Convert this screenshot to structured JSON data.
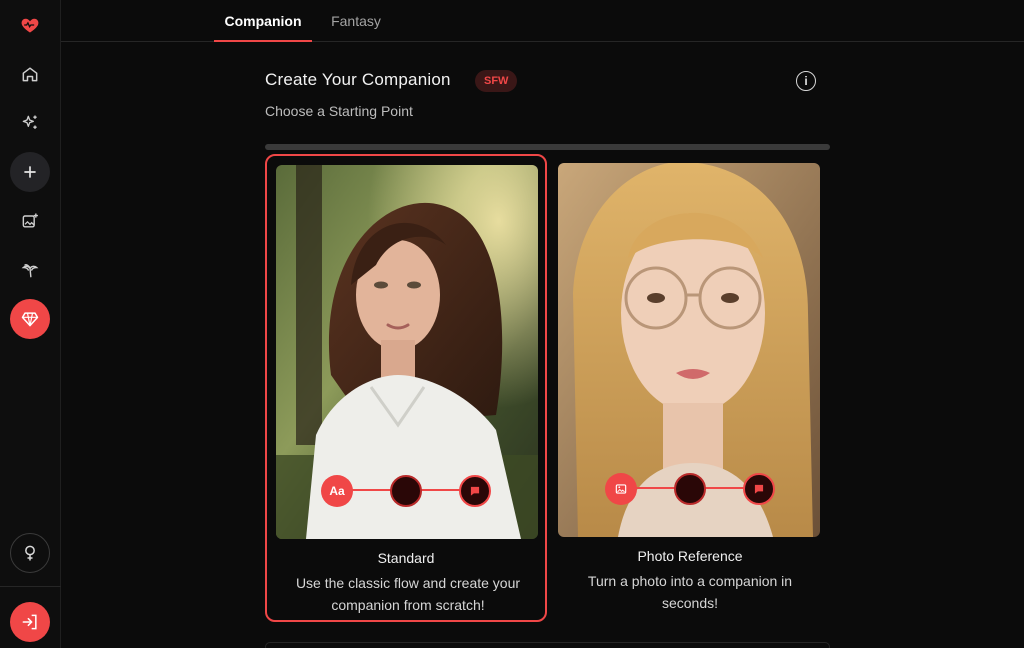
{
  "tabs": [
    {
      "label": "Companion",
      "active": true
    },
    {
      "label": "Fantasy",
      "active": false
    }
  ],
  "header": {
    "title": "Create Your Companion",
    "badge": "SFW",
    "subtitle": "Choose a Starting Point",
    "info_icon": "info-icon"
  },
  "progress": {
    "value": 0
  },
  "sidebar": {
    "items": [
      {
        "icon": "heart-pulse-logo-icon"
      },
      {
        "icon": "home-icon"
      },
      {
        "icon": "sparkles-icon"
      },
      {
        "icon": "plus-icon"
      },
      {
        "icon": "image-add-icon"
      },
      {
        "icon": "palm-tree-icon"
      },
      {
        "icon": "diamond-icon"
      },
      {
        "icon": "female-icon"
      },
      {
        "icon": "login-icon"
      }
    ]
  },
  "cards": [
    {
      "title": "Standard",
      "description": "Use the classic flow and create your companion from scratch!",
      "selected": true,
      "step_icons": [
        "text-aa-icon",
        "empty-step-icon",
        "chat-icon"
      ],
      "step_text": "Aa"
    },
    {
      "title": "Photo Reference",
      "description": "Turn a photo into a companion in seconds!",
      "selected": false,
      "step_icons": [
        "image-icon",
        "empty-step-icon",
        "chat-icon"
      ]
    }
  ],
  "colors": {
    "accent": "#f04747",
    "background": "#0b0b0b",
    "sidebar": "#0e0e0e"
  }
}
